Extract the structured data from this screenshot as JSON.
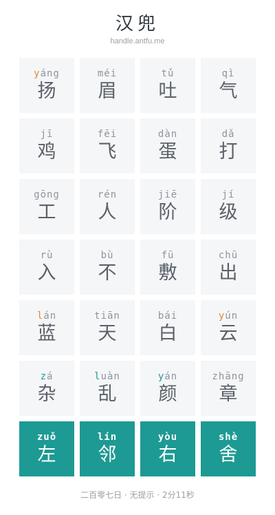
{
  "app": {
    "title": "汉兜",
    "subtitle": "handle.antfu.me"
  },
  "colors": {
    "correct": "#1d9a93",
    "present": "#e08a2c",
    "tile_bg": "#f5f6f8",
    "text": "#5a6168"
  },
  "rows": [
    [
      {
        "pinyin": [
          {
            "t": "y",
            "s": "present"
          },
          {
            "t": "áng",
            "s": "none"
          }
        ],
        "hanzi": "扬"
      },
      {
        "pinyin": [
          {
            "t": "méi",
            "s": "none"
          }
        ],
        "hanzi": "眉"
      },
      {
        "pinyin": [
          {
            "t": "tǔ",
            "s": "none"
          }
        ],
        "hanzi": "吐"
      },
      {
        "pinyin": [
          {
            "t": "qì",
            "s": "none"
          }
        ],
        "hanzi": "气"
      }
    ],
    [
      {
        "pinyin": [
          {
            "t": "jī",
            "s": "none"
          }
        ],
        "hanzi": "鸡"
      },
      {
        "pinyin": [
          {
            "t": "fēi",
            "s": "none"
          }
        ],
        "hanzi": "飞"
      },
      {
        "pinyin": [
          {
            "t": "dàn",
            "s": "none"
          }
        ],
        "hanzi": "蛋"
      },
      {
        "pinyin": [
          {
            "t": "dǎ",
            "s": "none"
          }
        ],
        "hanzi": "打"
      }
    ],
    [
      {
        "pinyin": [
          {
            "t": "gōng",
            "s": "none"
          }
        ],
        "hanzi": "工"
      },
      {
        "pinyin": [
          {
            "t": "rén",
            "s": "none"
          }
        ],
        "hanzi": "人"
      },
      {
        "pinyin": [
          {
            "t": "jiē",
            "s": "none"
          }
        ],
        "hanzi": "阶"
      },
      {
        "pinyin": [
          {
            "t": "jí",
            "s": "none"
          }
        ],
        "hanzi": "级"
      }
    ],
    [
      {
        "pinyin": [
          {
            "t": "rù",
            "s": "none"
          }
        ],
        "hanzi": "入"
      },
      {
        "pinyin": [
          {
            "t": "bù",
            "s": "none"
          }
        ],
        "hanzi": "不"
      },
      {
        "pinyin": [
          {
            "t": "fū",
            "s": "none"
          }
        ],
        "hanzi": "敷"
      },
      {
        "pinyin": [
          {
            "t": "chū",
            "s": "none"
          }
        ],
        "hanzi": "出"
      }
    ],
    [
      {
        "pinyin": [
          {
            "t": "l",
            "s": "present"
          },
          {
            "t": "án",
            "s": "none"
          }
        ],
        "hanzi": "蓝"
      },
      {
        "pinyin": [
          {
            "t": "tiān",
            "s": "none"
          }
        ],
        "hanzi": "天"
      },
      {
        "pinyin": [
          {
            "t": "bái",
            "s": "none"
          }
        ],
        "hanzi": "白"
      },
      {
        "pinyin": [
          {
            "t": "y",
            "s": "present"
          },
          {
            "t": "ún",
            "s": "none"
          }
        ],
        "hanzi": "云"
      }
    ],
    [
      {
        "pinyin": [
          {
            "t": "z",
            "s": "correct"
          },
          {
            "t": "á",
            "s": "none"
          }
        ],
        "hanzi": "杂"
      },
      {
        "pinyin": [
          {
            "t": "l",
            "s": "correct"
          },
          {
            "t": "uàn",
            "s": "none"
          }
        ],
        "hanzi": "乱"
      },
      {
        "pinyin": [
          {
            "t": "y",
            "s": "correct"
          },
          {
            "t": "án",
            "s": "none"
          }
        ],
        "hanzi": "颜"
      },
      {
        "pinyin": [
          {
            "t": "zhāng",
            "s": "none"
          }
        ],
        "hanzi": "章"
      }
    ],
    [
      {
        "pinyin": [
          {
            "t": "zuǒ",
            "s": "none"
          }
        ],
        "hanzi": "左",
        "state": "correct"
      },
      {
        "pinyin": [
          {
            "t": "lín",
            "s": "none"
          }
        ],
        "hanzi": "邻",
        "state": "correct"
      },
      {
        "pinyin": [
          {
            "t": "yòu",
            "s": "none"
          }
        ],
        "hanzi": "右",
        "state": "correct"
      },
      {
        "pinyin": [
          {
            "t": "shè",
            "s": "none"
          }
        ],
        "hanzi": "舍",
        "state": "correct"
      }
    ]
  ],
  "footer": {
    "text": "二百零七日 · 无提示 · 2分11秒"
  }
}
